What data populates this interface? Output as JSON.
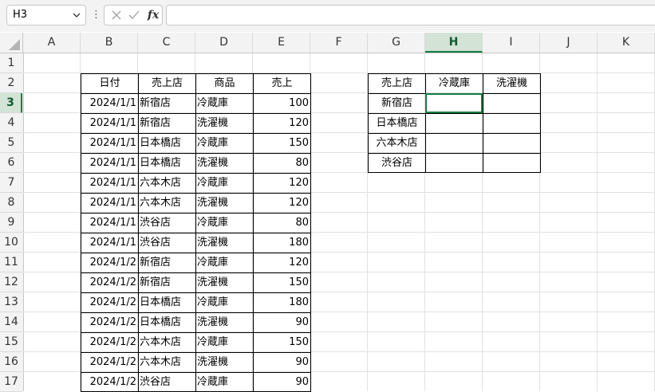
{
  "formula_bar": {
    "name_box": "H3",
    "cancel_icon": "×",
    "enter_icon": "✓",
    "function_icon": "fx",
    "formula": ""
  },
  "columns": [
    "A",
    "B",
    "C",
    "D",
    "E",
    "F",
    "G",
    "H",
    "I",
    "J",
    "K"
  ],
  "rows": [
    "1",
    "2",
    "3",
    "4",
    "5",
    "6",
    "7",
    "8",
    "9",
    "10",
    "11",
    "12",
    "13",
    "14",
    "15",
    "16",
    "17"
  ],
  "selected_cell": "H3",
  "colors": {
    "accent": "#107c41",
    "header_bg": "#f3f3f3",
    "grid": "#e1e1e1"
  },
  "sales_table": {
    "headers": [
      "日付",
      "売上店",
      "商品",
      "売上"
    ],
    "rows": [
      [
        "2024/1/1",
        "新宿店",
        "冷蔵庫",
        "100"
      ],
      [
        "2024/1/1",
        "新宿店",
        "洗濯機",
        "120"
      ],
      [
        "2024/1/1",
        "日本橋店",
        "冷蔵庫",
        "150"
      ],
      [
        "2024/1/1",
        "日本橋店",
        "洗濯機",
        "80"
      ],
      [
        "2024/1/1",
        "六本木店",
        "冷蔵庫",
        "120"
      ],
      [
        "2024/1/1",
        "六本木店",
        "洗濯機",
        "120"
      ],
      [
        "2024/1/1",
        "渋谷店",
        "冷蔵庫",
        "80"
      ],
      [
        "2024/1/1",
        "渋谷店",
        "洗濯機",
        "180"
      ],
      [
        "2024/1/2",
        "新宿店",
        "冷蔵庫",
        "120"
      ],
      [
        "2024/1/2",
        "新宿店",
        "洗濯機",
        "150"
      ],
      [
        "2024/1/2",
        "日本橋店",
        "冷蔵庫",
        "180"
      ],
      [
        "2024/1/2",
        "日本橋店",
        "洗濯機",
        "90"
      ],
      [
        "2024/1/2",
        "六本木店",
        "冷蔵庫",
        "150"
      ],
      [
        "2024/1/2",
        "六本木店",
        "洗濯機",
        "90"
      ],
      [
        "2024/1/2",
        "渋谷店",
        "冷蔵庫",
        "90"
      ]
    ]
  },
  "summary_table": {
    "headers": [
      "売上店",
      "冷蔵庫",
      "洗濯機"
    ],
    "stores": [
      "新宿店",
      "日本橋店",
      "六本木店",
      "渋谷店"
    ]
  }
}
